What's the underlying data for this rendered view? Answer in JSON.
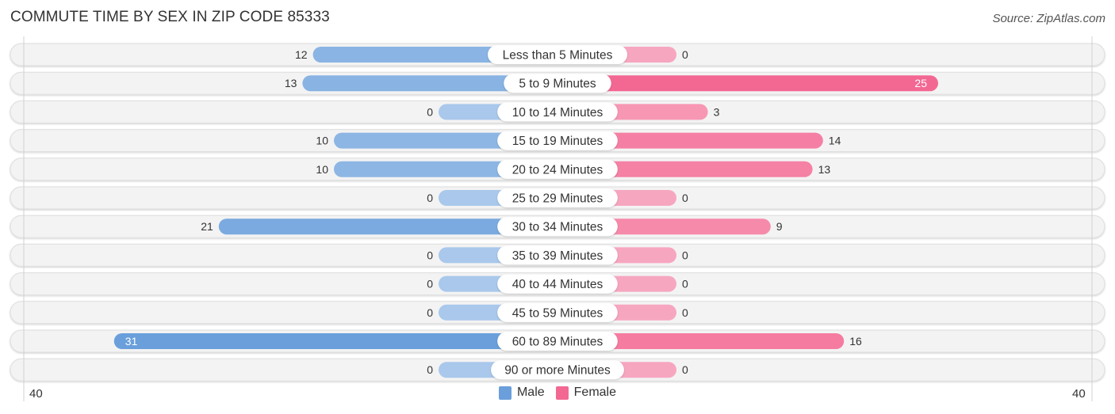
{
  "title": "COMMUTE TIME BY SEX IN ZIP CODE 85333",
  "source": "Source: ZipAtlas.com",
  "colors": {
    "male": "#6a9fdc",
    "male_light": "#a9c8eb",
    "female": "#f36893",
    "female_light": "#f7a6c0",
    "track": "#f3f3f3"
  },
  "chart_data": {
    "type": "bar",
    "orientation": "horizontal-diverging",
    "title": "COMMUTE TIME BY SEX IN ZIP CODE 85333",
    "categories": [
      "Less than 5 Minutes",
      "5 to 9 Minutes",
      "10 to 14 Minutes",
      "15 to 19 Minutes",
      "20 to 24 Minutes",
      "25 to 29 Minutes",
      "30 to 34 Minutes",
      "35 to 39 Minutes",
      "40 to 44 Minutes",
      "45 to 59 Minutes",
      "60 to 89 Minutes",
      "90 or more Minutes"
    ],
    "series": [
      {
        "name": "Male",
        "side": "left",
        "values": [
          12,
          13,
          0,
          10,
          10,
          0,
          21,
          0,
          0,
          0,
          31,
          0
        ]
      },
      {
        "name": "Female",
        "side": "right",
        "values": [
          0,
          25,
          3,
          14,
          13,
          0,
          9,
          0,
          0,
          0,
          16,
          0
        ]
      }
    ],
    "axis": {
      "left_label": "40",
      "right_label": "40",
      "range": [
        0,
        40
      ]
    },
    "legend": {
      "placement": "bottom-center",
      "entries": [
        "Male",
        "Female"
      ]
    },
    "grid": false
  }
}
